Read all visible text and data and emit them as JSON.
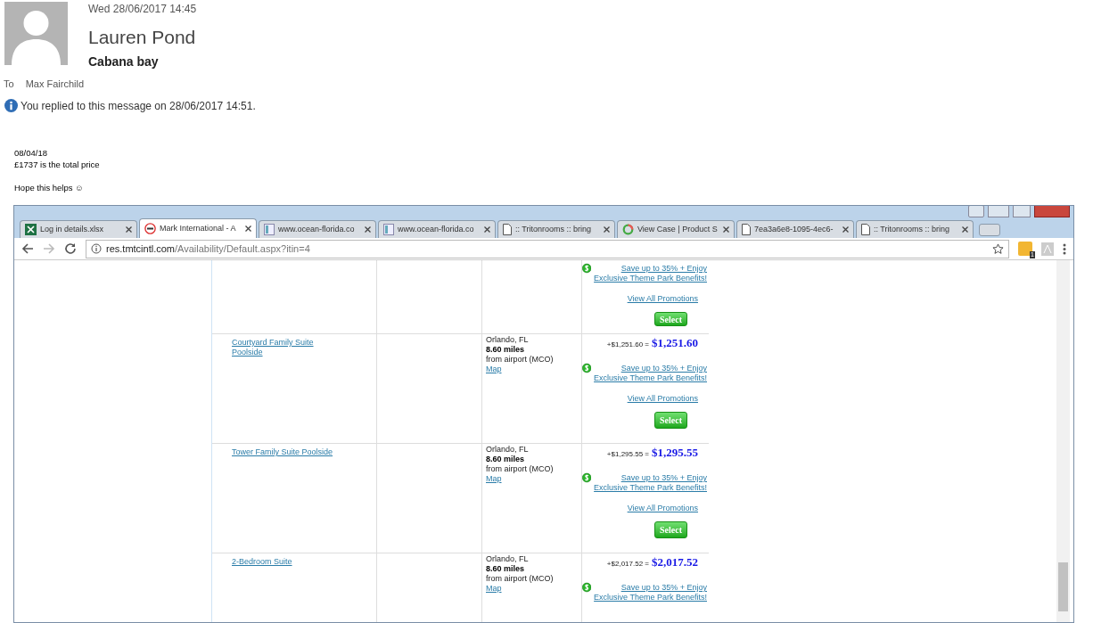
{
  "email": {
    "date": "Wed 28/06/2017 14:45",
    "sender": "Lauren Pond",
    "subject": "Cabana bay",
    "to_label": "To",
    "to": "Max Fairchild",
    "info": "You replied to this message on 28/06/2017 14:51.",
    "body": [
      "08/04/18",
      "£1737 is the total price",
      "Hope this helps ☺"
    ]
  },
  "browser": {
    "tabs": [
      {
        "label": "Log in details.xlsx",
        "kind": "excel",
        "selected": false
      },
      {
        "label": "Mark International - A",
        "kind": "logo",
        "selected": true
      },
      {
        "label": "www.ocean-florida.co",
        "kind": "doc",
        "selected": false
      },
      {
        "label": "www.ocean-florida.co",
        "kind": "doc",
        "selected": false
      },
      {
        "label": ":: Tritonrooms :: bring",
        "kind": "page",
        "selected": false
      },
      {
        "label": "View Case | Product S",
        "kind": "ring",
        "selected": false
      },
      {
        "label": "7ea3a6e8-1095-4ec6-",
        "kind": "page",
        "selected": false
      },
      {
        "label": ":: Tritonrooms :: bring",
        "kind": "page",
        "selected": false
      }
    ],
    "address": {
      "host": "res.tmtcintl.com",
      "path": "/Availability/Default.aspx?itin=4"
    },
    "extension_badge": "1",
    "rows": [
      {
        "kind": "partial",
        "promo": "Save up to 35% + Enjoy Exclusive Theme Park Benefits!",
        "view_all": "View All Promotions",
        "select": "Select"
      },
      {
        "kind": "full",
        "room": "Courtyard Family Suite Poolside",
        "city": "Orlando, FL",
        "distance": "8.60 miles",
        "from": "from airport (MCO)",
        "map": "Map",
        "price_small": "+$1,251.60 =",
        "price": "$1,251.60",
        "promo": "Save up to 35% + Enjoy Exclusive Theme Park Benefits!",
        "view_all": "View All Promotions",
        "select": "Select"
      },
      {
        "kind": "full",
        "room": "Tower Family Suite Poolside",
        "city": "Orlando, FL",
        "distance": "8.60 miles",
        "from": "from airport (MCO)",
        "map": "Map",
        "price_small": "+$1,295.55 =",
        "price": "$1,295.55",
        "promo": "Save up to 35% + Enjoy Exclusive Theme Park Benefits!",
        "view_all": "View All Promotions",
        "select": "Select"
      },
      {
        "kind": "cut",
        "room": "2-Bedroom Suite",
        "city": "Orlando, FL",
        "distance": "8.60 miles",
        "from": "from airport (MCO)",
        "map": "Map",
        "price_small": "+$2,017.52 =",
        "price": "$2,017.52",
        "promo": "Save up to 35% + Enjoy Exclusive Theme Park Benefits!"
      }
    ]
  }
}
